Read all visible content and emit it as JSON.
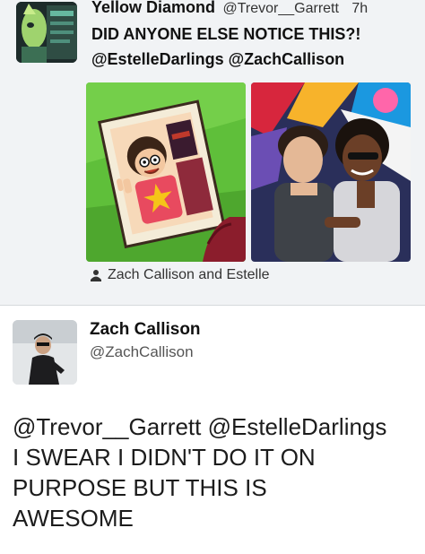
{
  "tweet1": {
    "display_name": "Yellow Diamond",
    "handle": "@Trevor__Garrett",
    "time": "7h",
    "text_line1": "DID ANYONE ELSE NOTICE THIS?!",
    "text_line2": "@EstelleDarlings @ZachCallison",
    "caption": "Zach Callison and Estelle",
    "caption_icon": "person-icon"
  },
  "tweet2": {
    "display_name": "Zach Callison",
    "handle": "@ZachCallison",
    "body_lines": [
      "@Trevor__Garrett @EstelleDarlings",
      "I SWEAR I DIDN'T DO IT ON",
      "PURPOSE BUT THIS IS",
      "AWESOME"
    ]
  },
  "colors": {
    "top_background": "#f1f3f5",
    "cartoon_green": "#5fbf3a",
    "star_yellow": "#f5c518",
    "text_dark": "#111111"
  }
}
